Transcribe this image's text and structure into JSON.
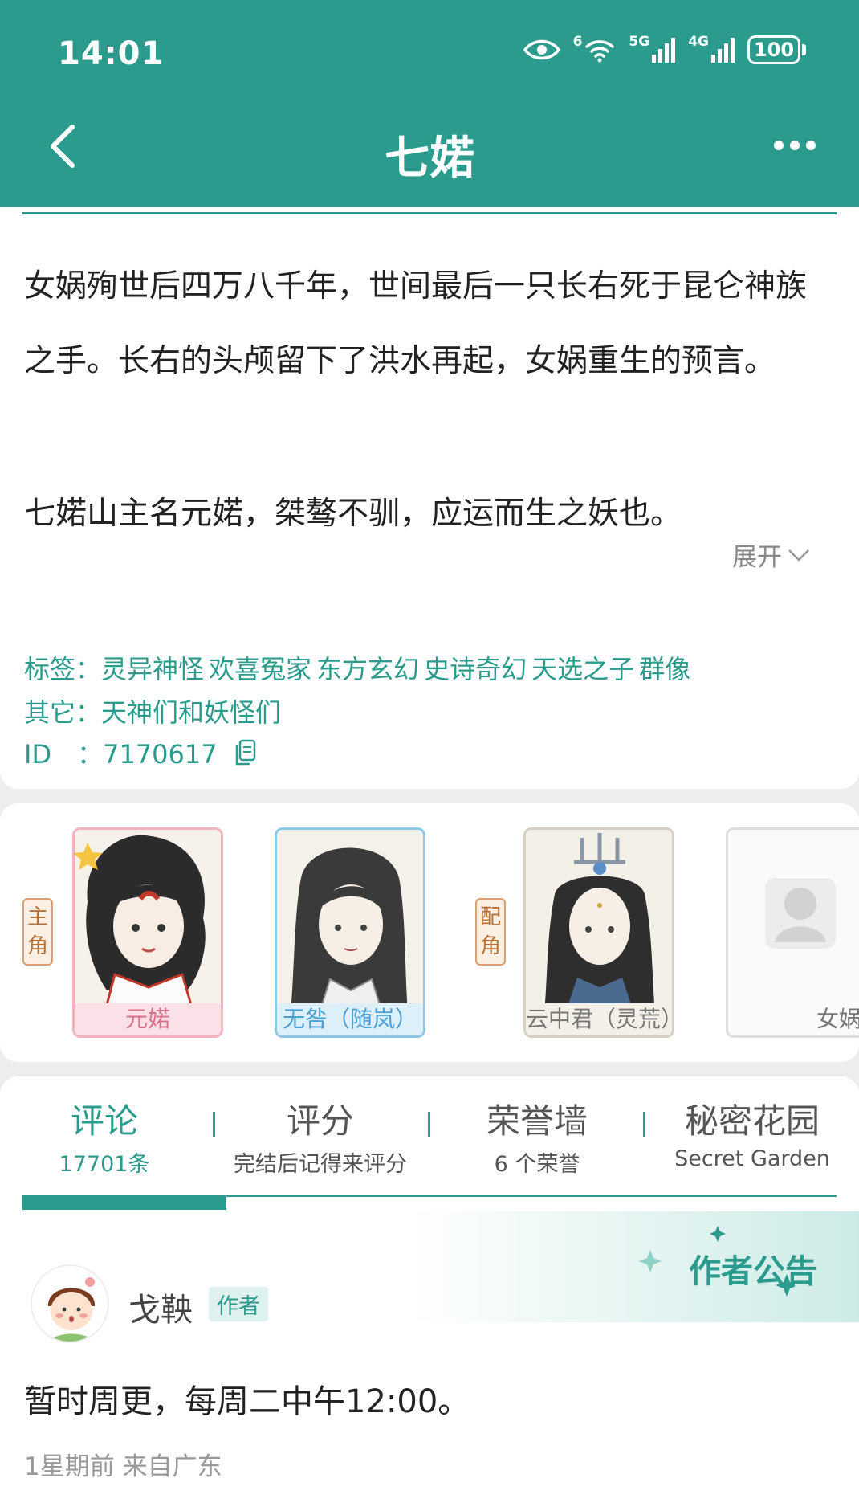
{
  "status_bar": {
    "time": "14:01",
    "network_5g": "5G",
    "network_4g": "4G",
    "wifi_label": "6",
    "battery": "100"
  },
  "header": {
    "title": "七婼"
  },
  "synopsis": {
    "text": "女娲殉世后四万八千年，世间最后一只长右死于昆仑神族之手。长右的头颅留下了洪水再起，女娲重生的预言。",
    "extra_line": "七婼山主名元婼，桀骜不驯，应运而生之妖也。",
    "expand_label": "展开"
  },
  "meta": {
    "tags_label": "标签：",
    "tags": [
      "灵异神怪",
      "欢喜冤家",
      "东方玄幻",
      "史诗奇幻",
      "天选之子",
      "群像"
    ],
    "other_label": "其它：",
    "other_value": "天神们和妖怪们",
    "id_label": "ID　：",
    "id_value": "7170617"
  },
  "characters": {
    "main_role_label": [
      "主",
      "角"
    ],
    "support_role_label": [
      "配",
      "角"
    ],
    "main": [
      {
        "name": "元婼"
      },
      {
        "name": "无咎（随岚）"
      }
    ],
    "support": [
      {
        "name": "云中君（灵荒）"
      },
      {
        "name": "女娲"
      }
    ]
  },
  "tabs": [
    {
      "label": "评论",
      "sub": "17701条",
      "active": true
    },
    {
      "label": "评分",
      "sub": "完结后记得来评分",
      "active": false
    },
    {
      "label": "荣誉墙",
      "sub": "6 个荣誉",
      "active": false
    },
    {
      "label": "秘密花园",
      "sub": "Secret Garden",
      "active": false
    }
  ],
  "announcement": {
    "title": "作者公告",
    "author_name": "戈鞅",
    "author_badge": "作者",
    "content": "暂时周更，每周二中午12:00。",
    "meta": "1星期前 来自广东"
  },
  "colors": {
    "accent": "#2a9b8c",
    "main_card_border": "#f2b2c0",
    "main_card_label_bg": "#fbe1e7",
    "main2_card_border": "#8cc8e6",
    "main2_card_label_bg": "#ddeff9",
    "support_card_border": "#d7d1c4"
  }
}
